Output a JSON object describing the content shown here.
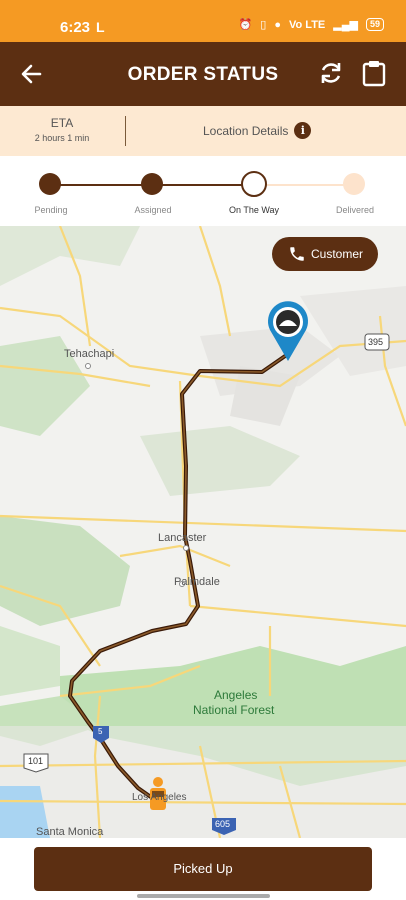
{
  "status_bar": {
    "time": "6:23",
    "left_icon": "L",
    "network": "Vo LTE",
    "battery": "59"
  },
  "app_bar": {
    "title": "ORDER STATUS",
    "icons": [
      "back-arrow-icon",
      "refresh-icon",
      "clipboard-icon"
    ]
  },
  "eta": {
    "label": "ETA",
    "value": "2 hours 1 min",
    "location_details": "Location Details"
  },
  "stepper": {
    "steps": [
      {
        "label": "Pending",
        "state": "done"
      },
      {
        "label": "Assigned",
        "state": "done"
      },
      {
        "label": "On The Way",
        "state": "current"
      },
      {
        "label": "Delivered",
        "state": "upcoming"
      }
    ],
    "colors": {
      "done": "#5c2f12",
      "upcoming": "#fde3cc"
    }
  },
  "map": {
    "labels": {
      "tehachapi": "Tehachapi",
      "lancaster": "Lancaster",
      "palmdale": "Palmdale",
      "angeles_1": "Angeles",
      "angeles_2": "National Forest",
      "los_angeles": "Los Angeles",
      "santa_monica": "Santa Monica"
    },
    "shields": {
      "i5": "5",
      "us101": "101",
      "ca395": "395",
      "i605": "605"
    },
    "customer_button": "Customer"
  },
  "action": {
    "picked_up": "Picked Up"
  },
  "colors": {
    "brand": "#5c2f12",
    "accent": "#f59a23",
    "eta_background": "#fde9d2"
  }
}
